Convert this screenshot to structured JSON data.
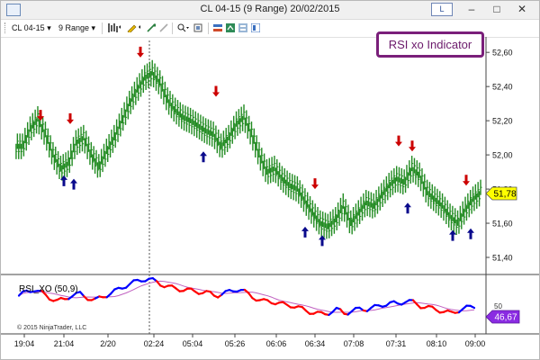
{
  "window": {
    "title": "CL 04-15 (9 Range)  20/02/2015",
    "link_button": "L",
    "minimize": "–",
    "maximize": "□",
    "close": "✕"
  },
  "toolbar": {
    "instrument": "CL 04-15",
    "interval": "9 Range"
  },
  "annotation_badge": "RSI xo Indicator",
  "price_panel": {
    "y_ticks": [
      "52,60",
      "52,40",
      "52,20",
      "52,00",
      "51,80",
      "51,60",
      "51,40"
    ],
    "y_tick_values": [
      52.6,
      52.4,
      52.2,
      52.0,
      51.8,
      51.6,
      51.4
    ],
    "current_price_label": "51,78",
    "current_price": 51.78,
    "current_price_color": "#ffff00",
    "bar_color": "#228b22",
    "sell_arrow_color": "#cc0000",
    "buy_arrow_color": "#0a0a8c"
  },
  "indicator_panel": {
    "label": "RSI_XO (50,9)",
    "top_tick_label": "50",
    "current_value_label": "46,67",
    "current_value_color": "#8a2be2",
    "fast_line_colors": [
      "#0000ff",
      "#ff0000"
    ],
    "slow_line_color": "#c060c0"
  },
  "copyright": "© 2015 NinjaTrader, LLC",
  "x_ticks": [
    "19:04",
    "21:04",
    "2/20",
    "02:24",
    "05:04",
    "05:26",
    "06:06",
    "06:34",
    "07:08",
    "07:31",
    "08:10",
    "09:00"
  ],
  "chart_data": {
    "type": "line",
    "title": "CL 04-15 (9 Range)  20/02/2015",
    "price_closes": [
      52.05,
      52.15,
      52.21,
      52.12,
      52.0,
      51.92,
      51.95,
      52.07,
      52.1,
      52.0,
      51.93,
      52.02,
      52.1,
      52.2,
      52.3,
      52.38,
      52.45,
      52.48,
      52.42,
      52.32,
      52.26,
      52.22,
      52.2,
      52.17,
      52.14,
      52.12,
      52.05,
      52.1,
      52.18,
      52.22,
      52.12,
      52.0,
      51.9,
      51.92,
      51.86,
      51.82,
      51.8,
      51.73,
      51.66,
      51.6,
      51.58,
      51.62,
      51.7,
      51.6,
      51.66,
      51.72,
      51.7,
      51.76,
      51.82,
      51.86,
      51.84,
      51.92,
      51.88,
      51.78,
      51.74,
      51.7,
      51.64,
      51.6,
      51.68,
      51.74,
      51.78
    ],
    "sell_arrow_prices": [
      52.2,
      52.18,
      52.57,
      52.34,
      51.8,
      52.05,
      52.02,
      51.82
    ],
    "buy_arrow_prices": [
      51.88,
      51.86,
      52.02,
      51.58,
      51.53,
      51.72,
      51.56,
      51.57
    ],
    "rsi_value": 46.67,
    "ylabel": "",
    "xlabel": ""
  }
}
